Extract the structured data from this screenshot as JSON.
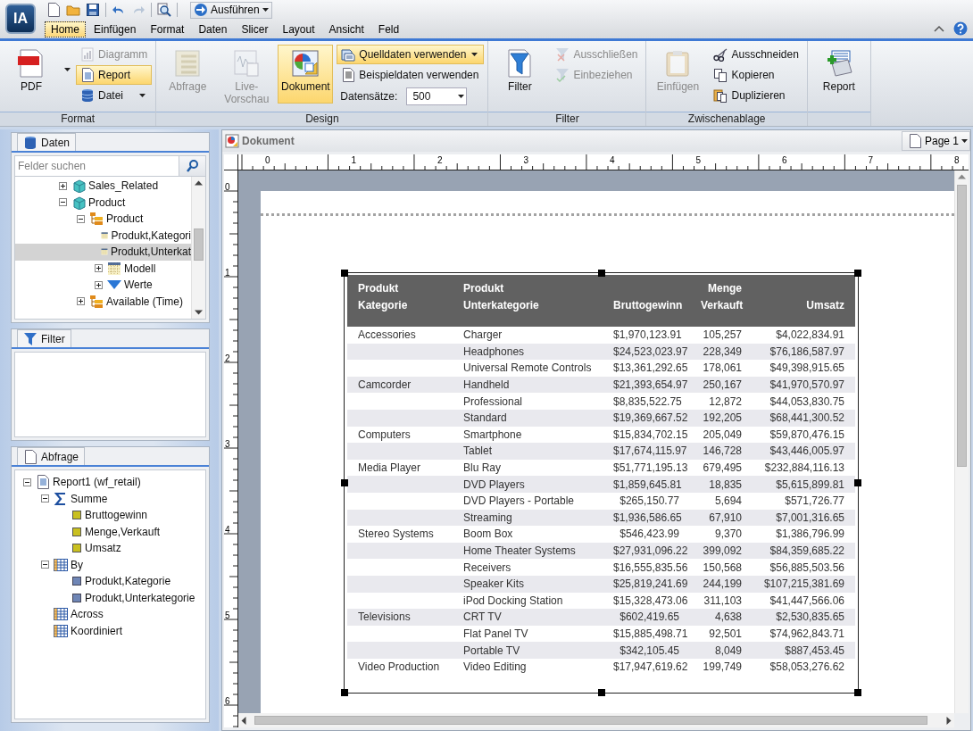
{
  "app": {
    "logo": "IA",
    "run_button": "Ausführen"
  },
  "menu_tabs": [
    {
      "label": "Home",
      "selected": true
    },
    {
      "label": "Einfügen",
      "selected": false
    },
    {
      "label": "Format",
      "selected": false
    },
    {
      "label": "Daten",
      "selected": false
    },
    {
      "label": "Slicer",
      "selected": false
    },
    {
      "label": "Layout",
      "selected": false
    },
    {
      "label": "Ansicht",
      "selected": false
    },
    {
      "label": "Feld",
      "selected": false
    }
  ],
  "ribbon": {
    "groups": [
      {
        "title": "Format",
        "items": [
          {
            "kind": "large",
            "label": "PDF",
            "disabled": false,
            "selected": false,
            "dropdown": true
          },
          {
            "kind": "stack",
            "items": [
              {
                "kind": "small",
                "label": "Diagramm",
                "disabled": true,
                "selected": false
              },
              {
                "kind": "small",
                "label": "Report",
                "disabled": false,
                "selected": true
              },
              {
                "kind": "small",
                "label": "Datei",
                "disabled": false,
                "selected": false,
                "dropdown": true
              }
            ]
          }
        ]
      },
      {
        "title": "Design",
        "items": [
          {
            "kind": "large",
            "label": "Abfrage",
            "disabled": true,
            "selected": false
          },
          {
            "kind": "large",
            "label": "Live-Vorschau",
            "disabled": true,
            "selected": false
          },
          {
            "kind": "large",
            "label": "Dokument",
            "disabled": false,
            "selected": true
          },
          {
            "kind": "stack",
            "items": [
              {
                "kind": "small",
                "label": "Quelldaten verwenden",
                "disabled": false,
                "selected": true,
                "dropdown": true
              },
              {
                "kind": "small",
                "label": "Beispieldaten verwenden",
                "disabled": false,
                "selected": false
              },
              {
                "kind": "field",
                "label": "Datensätze:",
                "value": "500"
              }
            ]
          }
        ]
      },
      {
        "title": "Filter",
        "items": [
          {
            "kind": "large",
            "label": "Filter",
            "disabled": false,
            "selected": false
          },
          {
            "kind": "stack",
            "items": [
              {
                "kind": "small",
                "label": "Ausschließen",
                "disabled": true,
                "selected": false
              },
              {
                "kind": "small",
                "label": "Einbeziehen",
                "disabled": true,
                "selected": false
              }
            ]
          }
        ]
      },
      {
        "title": "Zwischenablage",
        "items": [
          {
            "kind": "large",
            "label": "Einfügen",
            "disabled": true,
            "selected": false
          },
          {
            "kind": "stack",
            "items": [
              {
                "kind": "small",
                "label": "Ausschneiden",
                "disabled": false,
                "selected": false
              },
              {
                "kind": "small",
                "label": "Kopieren",
                "disabled": false,
                "selected": false
              },
              {
                "kind": "small",
                "label": "Duplizieren",
                "disabled": false,
                "selected": false
              }
            ]
          }
        ]
      },
      {
        "items": [
          {
            "kind": "large",
            "label": "Report",
            "disabled": false,
            "selected": false
          }
        ]
      }
    ]
  },
  "daten_panel": {
    "title": "Daten",
    "search": {
      "placeholder": "Felder suchen"
    },
    "tree": [
      {
        "kind": "cube",
        "label": "Sales_Related",
        "expanded": false,
        "selected": false
      },
      {
        "kind": "cube",
        "label": "Product",
        "expanded": true,
        "selected": false,
        "children": [
          {
            "kind": "hierarchy",
            "label": "Product",
            "expanded": true,
            "selected": false,
            "children": [
              {
                "kind": "field",
                "label": "Produkt,Kategori",
                "selected": false
              },
              {
                "kind": "field",
                "label": "Produkt,Unterkat",
                "selected": true
              },
              {
                "kind": "field",
                "label": "Modell",
                "expanded": false,
                "selected": false
              },
              {
                "kind": "measure",
                "label": "Werte",
                "expanded": false,
                "selected": false
              }
            ]
          },
          {
            "kind": "hierarchy",
            "label": "Available (Time)",
            "expanded": false,
            "selected": false
          }
        ]
      }
    ]
  },
  "filter_panel": {
    "title": "Filter"
  },
  "abfrage_panel": {
    "title": "Abfrage",
    "tree": [
      {
        "kind": "report",
        "label": "Report1 (wf_retail)",
        "expanded": true,
        "children": [
          {
            "kind": "sum",
            "label": "Summe",
            "expanded": true,
            "children": [
              {
                "kind": "measure-item",
                "label": "Bruttogewinn"
              },
              {
                "kind": "measure-item",
                "label": "Menge,Verkauft"
              },
              {
                "kind": "measure-item",
                "label": "Umsatz"
              }
            ]
          },
          {
            "kind": "grid",
            "label": "By",
            "expanded": true,
            "children": [
              {
                "kind": "dimension-item",
                "label": "Produkt,Kategorie"
              },
              {
                "kind": "dimension-item",
                "label": "Produkt,Unterkategorie"
              }
            ]
          },
          {
            "kind": "grid",
            "label": "Across"
          },
          {
            "kind": "grid",
            "label": "Koordiniert"
          }
        ]
      }
    ]
  },
  "document": {
    "title": "Dokument",
    "page_button": "Page 1",
    "ruler": {
      "x_labels": [
        "0",
        "1",
        "2",
        "3",
        "4",
        "5",
        "6",
        "7",
        "8"
      ],
      "y_labels": [
        "0",
        "1",
        "2",
        "3",
        "4",
        "5",
        "6"
      ]
    },
    "report": {
      "columns": [
        {
          "lines": [
            "Produkt",
            "Kategorie"
          ]
        },
        {
          "lines": [
            "Produkt",
            "Unterkategorie"
          ]
        },
        {
          "lines": [
            "Bruttogewinn"
          ]
        },
        {
          "lines": [
            "Menge",
            "Verkauft"
          ]
        },
        {
          "lines": [
            "Umsatz"
          ]
        }
      ],
      "rows": [
        {
          "category": "Accessories",
          "subcategory": "Charger",
          "gross": "$1,970,123.91",
          "quantity": "105,257",
          "sales": "$4,022,834.91"
        },
        {
          "subcategory": "Headphones",
          "gross": "$24,523,023.97",
          "quantity": "228,349",
          "sales": "$76,186,587.97"
        },
        {
          "subcategory": "Universal Remote Controls",
          "gross": "$13,361,292.65",
          "quantity": "178,061",
          "sales": "$49,398,915.65"
        },
        {
          "category": "Camcorder",
          "subcategory": "Handheld",
          "gross": "$21,393,654.97",
          "quantity": "250,167",
          "sales": "$41,970,570.97"
        },
        {
          "subcategory": "Professional",
          "gross": "$8,835,522.75",
          "quantity": "12,872",
          "sales": "$44,053,830.75"
        },
        {
          "subcategory": "Standard",
          "gross": "$19,369,667.52",
          "quantity": "192,205",
          "sales": "$68,441,300.52"
        },
        {
          "category": "Computers",
          "subcategory": "Smartphone",
          "gross": "$15,834,702.15",
          "quantity": "205,049",
          "sales": "$59,870,476.15"
        },
        {
          "subcategory": "Tablet",
          "gross": "$17,674,115.97",
          "quantity": "146,728",
          "sales": "$43,446,005.97"
        },
        {
          "category": "Media Player",
          "subcategory": "Blu Ray",
          "gross": "$51,771,195.13",
          "quantity": "679,495",
          "sales": "$232,884,116.13"
        },
        {
          "subcategory": "DVD Players",
          "gross": "$1,859,645.81",
          "quantity": "18,835",
          "sales": "$5,615,899.81"
        },
        {
          "subcategory": "DVD Players - Portable",
          "gross": "$265,150.77",
          "quantity": "5,694",
          "sales": "$571,726.77"
        },
        {
          "subcategory": "Streaming",
          "gross": "$1,936,586.65",
          "quantity": "67,910",
          "sales": "$7,001,316.65"
        },
        {
          "category": "Stereo Systems",
          "subcategory": "Boom Box",
          "gross": "$546,423.99",
          "quantity": "9,370",
          "sales": "$1,386,796.99"
        },
        {
          "subcategory": "Home Theater Systems",
          "gross": "$27,931,096.22",
          "quantity": "399,092",
          "sales": "$84,359,685.22"
        },
        {
          "subcategory": "Receivers",
          "gross": "$16,555,835.56",
          "quantity": "150,568",
          "sales": "$56,885,503.56"
        },
        {
          "subcategory": "Speaker Kits",
          "gross": "$25,819,241.69",
          "quantity": "244,199",
          "sales": "$107,215,381.69"
        },
        {
          "subcategory": "iPod Docking Station",
          "gross": "$15,328,473.06",
          "quantity": "311,103",
          "sales": "$41,447,566.06"
        },
        {
          "category": "Televisions",
          "subcategory": "CRT TV",
          "gross": "$602,419.65",
          "quantity": "4,638",
          "sales": "$2,530,835.65"
        },
        {
          "subcategory": "Flat Panel TV",
          "gross": "$15,885,498.71",
          "quantity": "92,501",
          "sales": "$74,962,843.71"
        },
        {
          "subcategory": "Portable TV",
          "gross": "$342,105.45",
          "quantity": "8,049",
          "sales": "$887,453.45"
        },
        {
          "category": "Video Production",
          "subcategory": "Video Editing",
          "gross": "$17,947,619.62",
          "quantity": "199,749",
          "sales": "$58,053,276.62"
        }
      ]
    }
  }
}
